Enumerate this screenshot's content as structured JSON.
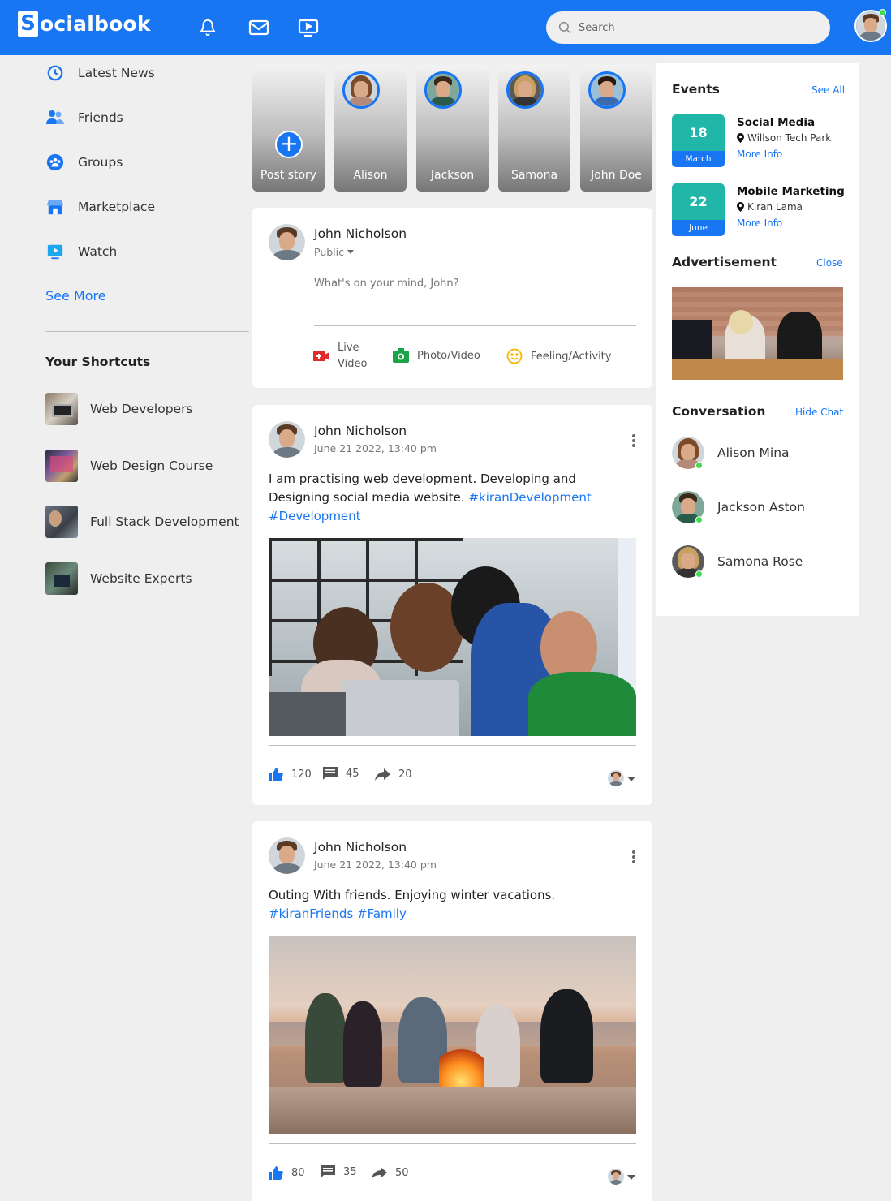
{
  "header": {
    "logo_letter": "S",
    "logo_text": "ocialbook",
    "search_placeholder": "Search",
    "nav_icons": [
      "bell-icon",
      "mail-icon",
      "video-icon"
    ],
    "brand_color": "#1876f2"
  },
  "left_nav": {
    "items": [
      {
        "label": "Latest News",
        "icon": "clock-icon"
      },
      {
        "label": "Friends",
        "icon": "friends-icon"
      },
      {
        "label": "Groups",
        "icon": "groups-icon"
      },
      {
        "label": "Marketplace",
        "icon": "store-icon"
      },
      {
        "label": "Watch",
        "icon": "watch-icon"
      }
    ],
    "see_more": "See More",
    "shortcuts_title": "Your Shortcuts",
    "shortcuts": [
      {
        "label": "Web Developers"
      },
      {
        "label": "Web Design Course"
      },
      {
        "label": "Full Stack Development"
      },
      {
        "label": "Website Experts"
      }
    ]
  },
  "stories": [
    {
      "label": "Post story"
    },
    {
      "label": "Alison"
    },
    {
      "label": "Jackson"
    },
    {
      "label": "Samona"
    },
    {
      "label": "John Doe"
    }
  ],
  "composer": {
    "user_name": "John Nicholson",
    "privacy": "Public",
    "placeholder": "What's on your mind, John?",
    "actions": {
      "live_line1": "Live",
      "live_line2": "Video",
      "photo": "Photo/Video",
      "feeling": "Feeling/Activity"
    }
  },
  "posts": [
    {
      "user_name": "John Nicholson",
      "timestamp": "June 21 2022, 13:40 pm",
      "text": "I am practising web development. Developing and Designing social media website.",
      "tags": [
        "#kiranDevelopment",
        "#Development"
      ],
      "likes": "120",
      "comments": "45",
      "shares": "20"
    },
    {
      "user_name": "John Nicholson",
      "timestamp": "June 21 2022, 13:40 pm",
      "text": "Outing With friends. Enjoying winter vacations.",
      "tags": [
        "#kiranFriends",
        "#Family"
      ],
      "likes": "80",
      "comments": "35",
      "shares": "50"
    }
  ],
  "events": {
    "title": "Events",
    "see_all": "See All",
    "items": [
      {
        "day": "18",
        "month": "March",
        "title": "Social Media",
        "location": "Willson Tech Park",
        "more": "More Info"
      },
      {
        "day": "22",
        "month": "June",
        "title": "Mobile Marketing",
        "location": "Kiran Lama",
        "more": "More Info"
      }
    ]
  },
  "advertisement": {
    "title": "Advertisement",
    "close": "Close"
  },
  "conversation": {
    "title": "Conversation",
    "hide": "Hide Chat",
    "people": [
      {
        "name": "Alison Mina"
      },
      {
        "name": "Jackson Aston"
      },
      {
        "name": "Samona Rose"
      }
    ]
  }
}
